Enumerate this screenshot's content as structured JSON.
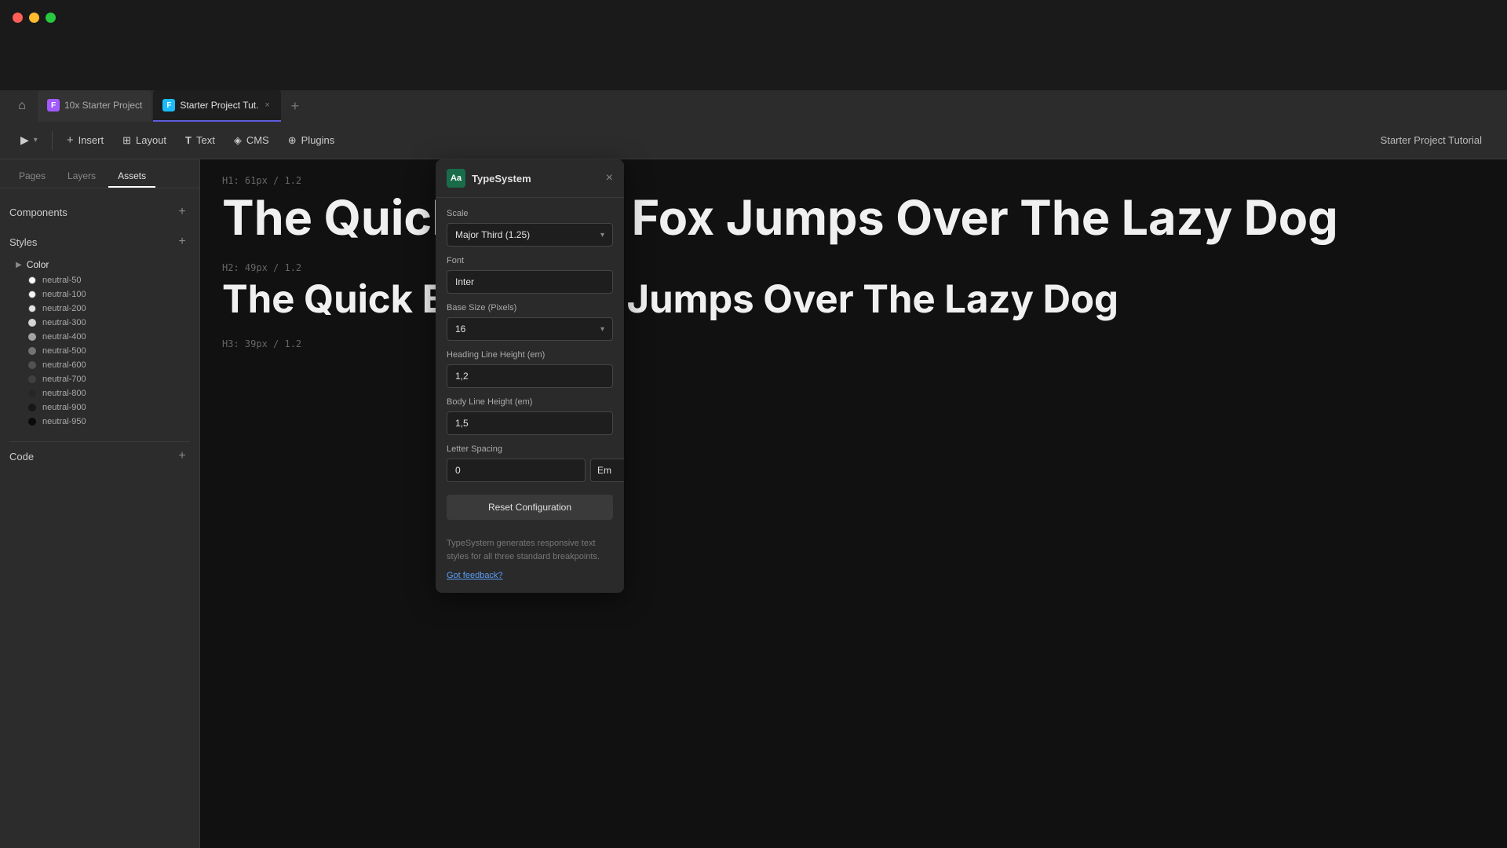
{
  "app": {
    "title": "Starter Project Tutorial",
    "top_bg": "#1a1a1a"
  },
  "tabs": {
    "home_icon": "⌂",
    "items": [
      {
        "id": "tab-10x",
        "label": "10x Starter Project",
        "icon_text": "F",
        "icon_color": "#a259ff",
        "active": false
      },
      {
        "id": "tab-starter",
        "label": "Starter Project Tut.",
        "icon_text": "F",
        "icon_color": "#1abcfe",
        "active": true,
        "closable": true
      }
    ],
    "add_label": "+"
  },
  "toolbar": {
    "items": [
      {
        "id": "selector-tool",
        "label": "▶",
        "has_arrow": true
      },
      {
        "id": "insert-btn",
        "label": "Insert",
        "icon": "+"
      },
      {
        "id": "layout-btn",
        "label": "Layout",
        "icon": "⊞"
      },
      {
        "id": "text-btn",
        "label": "Text",
        "icon": "T"
      },
      {
        "id": "cms-btn",
        "label": "CMS",
        "icon": "◈"
      },
      {
        "id": "plugins-btn",
        "label": "Plugins",
        "icon": "⊕"
      }
    ],
    "project_title": "Starter Project Tutorial"
  },
  "left_panel": {
    "tabs": [
      "Pages",
      "Layers",
      "Assets"
    ],
    "active_tab": "Assets",
    "components_label": "Components",
    "styles_label": "Styles",
    "code_label": "Code",
    "color_group": {
      "label": "Color",
      "swatches": [
        {
          "name": "neutral-50",
          "color": "#fafafa"
        },
        {
          "name": "neutral-100",
          "color": "#f5f5f5"
        },
        {
          "name": "neutral-200",
          "color": "#e5e5e5"
        },
        {
          "name": "neutral-300",
          "color": "#d4d4d4"
        },
        {
          "name": "neutral-400",
          "color": "#a3a3a3"
        },
        {
          "name": "neutral-500",
          "color": "#737373"
        },
        {
          "name": "neutral-600",
          "color": "#525252"
        },
        {
          "name": "neutral-700",
          "color": "#404040"
        },
        {
          "name": "neutral-800",
          "color": "#262626"
        },
        {
          "name": "neutral-900",
          "color": "#171717"
        },
        {
          "name": "neutral-950",
          "color": "#0a0a0a"
        }
      ]
    }
  },
  "plugin_dialog": {
    "logo_text": "Aa",
    "title": "TypeSystem",
    "close_icon": "×",
    "scale_label": "Scale",
    "scale_value": "Major Third (1.25)",
    "scale_arrow": "▾",
    "font_label": "Font",
    "font_value": "Inter",
    "base_size_label": "Base Size (Pixels)",
    "base_size_value": "16",
    "heading_line_height_label": "Heading Line Height (em)",
    "heading_line_height_value": "1,2",
    "body_line_height_label": "Body Line Height (em)",
    "body_line_height_value": "1,5",
    "letter_spacing_label": "Letter Spacing",
    "letter_spacing_value": "0",
    "letter_spacing_unit": "Em",
    "letter_spacing_unit_arrow": "▾",
    "reset_btn_label": "Reset Configuration",
    "footer_text": "TypeSystem generates responsive text styles for all three standard breakpoints.",
    "feedback_link": "Got feedback?"
  },
  "preview": {
    "h1_label": "H1: 61px / 1.2",
    "h1_text": "The Quick Brown Fox Jumps Over The Lazy Dog",
    "h2_label": "H2: 49px / 1.2",
    "h2_text": "The Quick Brown Fox Jumps Over The Lazy Dog",
    "h3_label": "H3: 39px / 1.2",
    "h3_text_placeholder": ""
  }
}
